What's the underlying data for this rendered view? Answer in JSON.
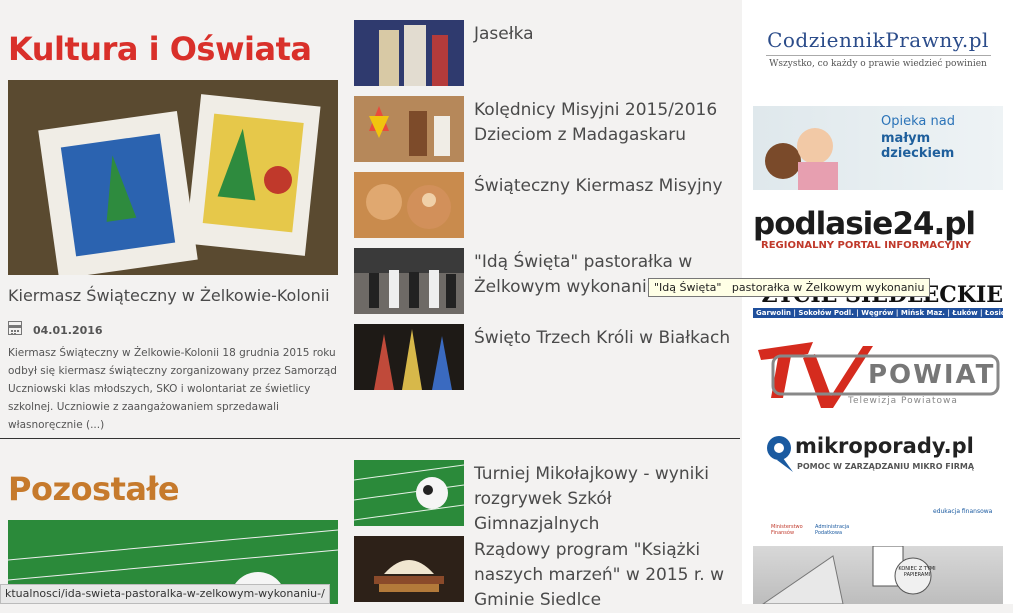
{
  "sections": {
    "culture": {
      "title": "Kultura i Oświata",
      "featured": {
        "title": "Kiermasz Świąteczny w Żelkowie-Kolonii",
        "date": "04.01.2016",
        "excerpt": "Kiermasz Świąteczny w Żelkowie-Kolonii 18 grudnia 2015 roku odbył się kiermasz świąteczny zorganizowany przez Samorząd Uczniowski klas młodszych, SKO i wolontariat ze świetlicy szkolnej. Uczniowie z zaangażowaniem sprzedawali własnoręcznie (...)"
      },
      "items": [
        {
          "title": "Jasełka"
        },
        {
          "title": "Kolędnicy Misyjni 2015/2016 Dzieciom z Madagaskaru"
        },
        {
          "title": "Świąteczny Kiermasz Misyjny"
        },
        {
          "title": "\"Idą Święta\" pastorałka w Żelkowym wykonaniu"
        },
        {
          "title": "Święto Trzech Króli w Białkach"
        }
      ]
    },
    "other": {
      "title": "Pozostałe",
      "items": [
        {
          "title": "Turniej Mikołajkowy - wyniki rozgrywek Szkół Gimnazjalnych"
        },
        {
          "title": "Rządowy program \"Książki naszych marzeń\" w 2015 r. w Gminie Siedlce"
        }
      ]
    }
  },
  "tooltip": "\"Idą Święta\"   pastorałka w Żelkowym wykonaniu",
  "statusbar": "ktualnosci/ida-swieta-pastoralka-w-zelkowym-wykonaniu-/",
  "sidebar": {
    "codziennik": {
      "name": "CodziennikPrawny.pl",
      "tagline": "Wszystko, co każdy o prawie wiedzieć powinien"
    },
    "opieka": {
      "line1": "Opieka nad",
      "line2": "małym dzieckiem"
    },
    "podlasie": {
      "name": "podlasie24.pl",
      "tagline": "REGIONALNY PORTAL INFORMACYJNY"
    },
    "zycie": {
      "name": "ŻYCIE SIEDLECKIE",
      "towns": "Garwolin | Sokołów Podl. | Węgrów | Mińsk Maz. | Łuków | Łosice"
    },
    "tvpowiat": {
      "name": "TV POWIAT",
      "tagline": "Telewizja Powiatowa"
    },
    "mikroporady": {
      "name": "mikroporady.pl",
      "tagline": "POMOC W ZARZĄDZANIU MIKRO FIRMĄ"
    },
    "pit": {
      "label1": "Ministerstwo Finansów",
      "label2": "Administracja Podatkowa",
      "label3": "edukacja finansowa",
      "note": "KONIEC Z TYMI PAPIERAMI"
    }
  }
}
